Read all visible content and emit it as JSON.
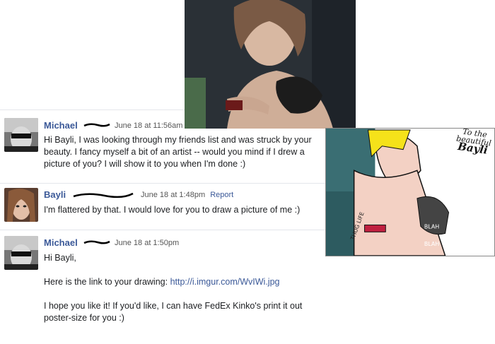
{
  "messages": [
    {
      "name": "Michael",
      "time": "June 18 at 11:56am",
      "text": "Hi Bayli, I was looking through my friends list and was struck by your beauty. I fancy myself a bit of an artist -- would you mind if I drew a picture of you? I will show it to you when I'm done :)"
    },
    {
      "name": "Bayli",
      "time": "June 18 at 1:48pm",
      "report": "Report",
      "text": "I'm flattered by that. I would love for you to draw a picture of me :)"
    },
    {
      "name": "Michael",
      "time": "June 18 at 1:50pm",
      "greeting": "Hi Bayli,",
      "link_prefix": "Here is the link to your drawing:",
      "link": "http://i.imgur.com/WvIWi.jpg",
      "closing": "I hope you like it! If you'd like, I can have FedEx Kinko's print it out poster-size for you :)"
    }
  ],
  "drawing": {
    "line1": "To the",
    "line2": "beautiful",
    "line3": "Bayli"
  },
  "colors": {
    "name": "#3b5998",
    "divider": "#e4e6eb"
  }
}
